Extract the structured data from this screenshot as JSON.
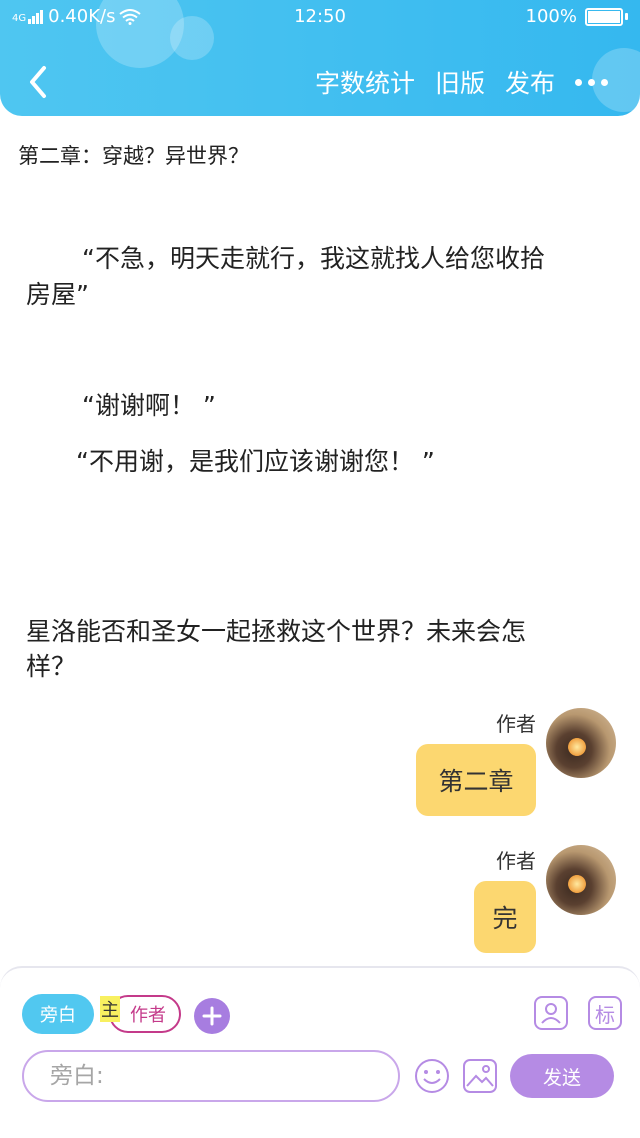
{
  "status_bar": {
    "network": "4G",
    "speed": "0.40K/s",
    "time": "12:50",
    "battery": "100%"
  },
  "nav": {
    "word_count": "字数统计",
    "old_version": "旧版",
    "publish": "发布"
  },
  "story": {
    "chapter_title": "第二章：穿越？异世界？",
    "paragraphs": [
      "“不急，明天走就行，我这就找人给您收拾",
      "房屋”",
      "“谢谢啊！ ”",
      "“不用谢，是我们应该谢谢您！ ”",
      "星洛能否和圣女一起拯救这个世界？未来会怎",
      "样？"
    ]
  },
  "messages": [
    {
      "author": "作者",
      "text": "第二章"
    },
    {
      "author": "作者",
      "text": "完"
    }
  ],
  "composer": {
    "role_narration": "旁白",
    "role_main": "主",
    "role_author": "作者",
    "tool_mark": "标",
    "input_placeholder": "旁白:",
    "send": "发送"
  },
  "colors": {
    "header": "#3dbcef",
    "bubble": "#fcd770",
    "accent_purple": "#b58be4",
    "author_chip": "#c43a8a"
  }
}
